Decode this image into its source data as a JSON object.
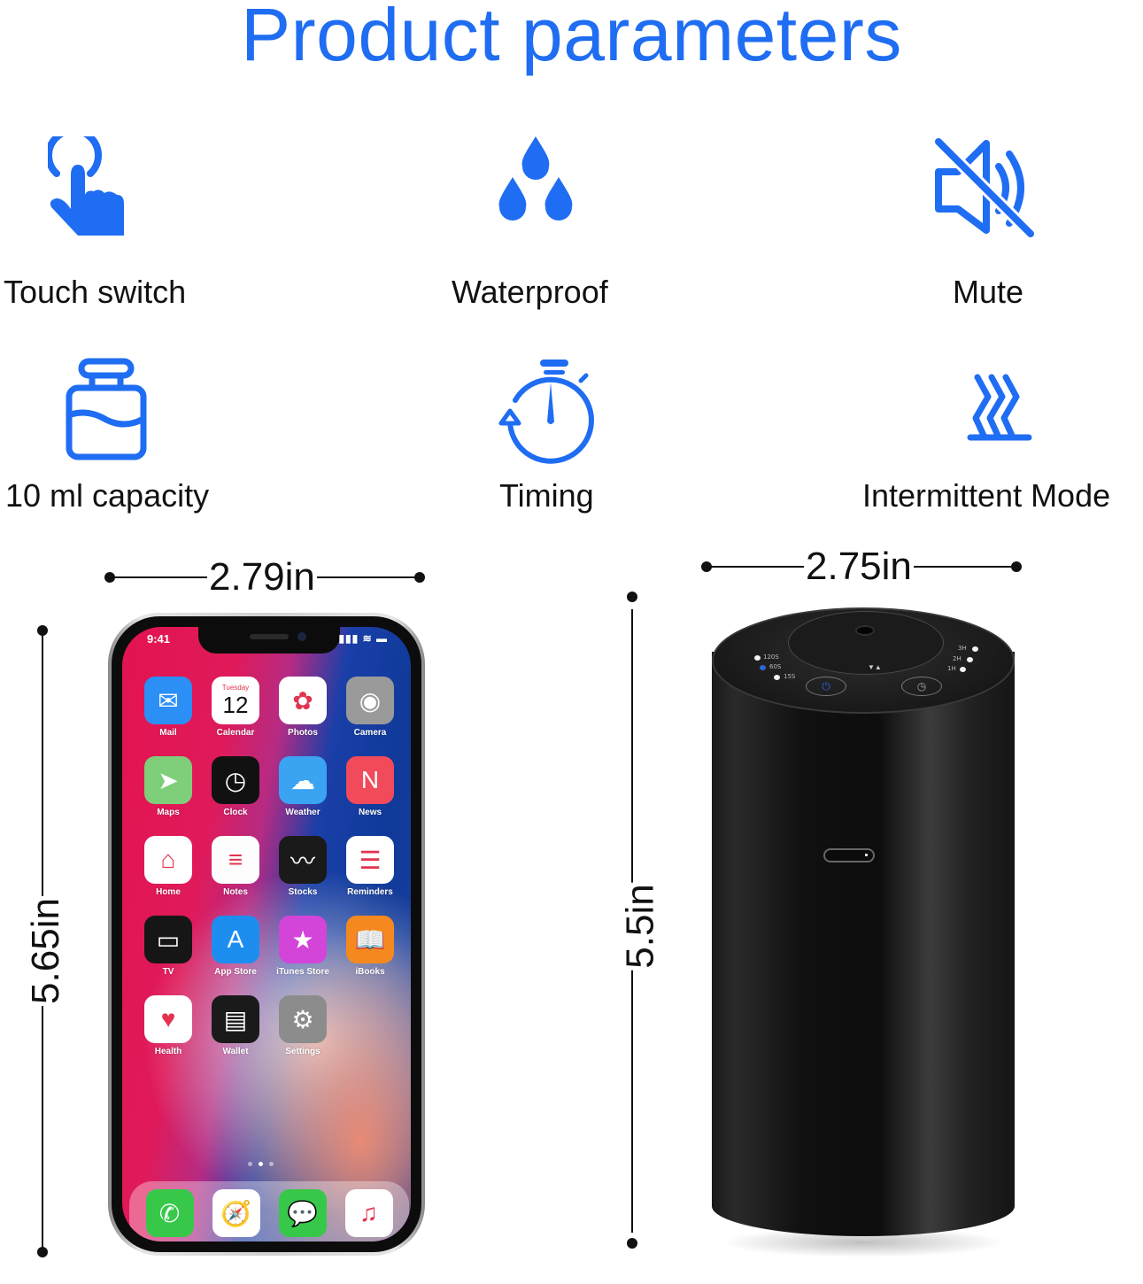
{
  "title": "Product parameters",
  "colors": {
    "accent": "#1f6df2",
    "text": "#111111"
  },
  "features": [
    {
      "label": "Touch switch",
      "icon": "touch-hand-icon"
    },
    {
      "label": "Waterproof",
      "icon": "water-drops-icon"
    },
    {
      "label": "Mute",
      "icon": "speaker-muted-icon"
    },
    {
      "label": "10 ml capacity",
      "icon": "bottle-icon"
    },
    {
      "label": "Timing",
      "icon": "stopwatch-icon"
    },
    {
      "label": "Intermittent Mode",
      "icon": "heat-waves-icon"
    }
  ],
  "dimensions": {
    "phone_width": "2.79in",
    "phone_height": "5.65in",
    "diffuser_width": "2.75in",
    "diffuser_height": "5.5in"
  },
  "phone": {
    "time": "9:41",
    "status_icons": "▮▮▮ ≋ ▬",
    "calendar_day": "Tuesday",
    "calendar_date": "12",
    "apps": [
      {
        "name": "Mail",
        "glyph": "✉",
        "color": "#2b8ff6"
      },
      {
        "name": "Calendar",
        "glyph": "12",
        "color": "#ffffff"
      },
      {
        "name": "Photos",
        "glyph": "✿",
        "color": "#ffffff"
      },
      {
        "name": "Camera",
        "glyph": "◉",
        "color": "#9a9a9a"
      },
      {
        "name": "Maps",
        "glyph": "➤",
        "color": "#7fcf7a"
      },
      {
        "name": "Clock",
        "glyph": "◷",
        "color": "#111111"
      },
      {
        "name": "Weather",
        "glyph": "☁",
        "color": "#3aa3f2"
      },
      {
        "name": "News",
        "glyph": "N",
        "color": "#f04a5b"
      },
      {
        "name": "Home",
        "glyph": "⌂",
        "color": "#ffffff"
      },
      {
        "name": "Notes",
        "glyph": "≡",
        "color": "#fdfdfd"
      },
      {
        "name": "Stocks",
        "glyph": "〰",
        "color": "#1a1a1a"
      },
      {
        "name": "Reminders",
        "glyph": "☰",
        "color": "#ffffff"
      },
      {
        "name": "TV",
        "glyph": "▭",
        "color": "#161616"
      },
      {
        "name": "App Store",
        "glyph": "A",
        "color": "#1d8ef0"
      },
      {
        "name": "iTunes Store",
        "glyph": "★",
        "color": "#d344d8"
      },
      {
        "name": "iBooks",
        "glyph": "📖",
        "color": "#f5891f"
      },
      {
        "name": "Health",
        "glyph": "♥",
        "color": "#ffffff"
      },
      {
        "name": "Wallet",
        "glyph": "▤",
        "color": "#1a1a1a"
      },
      {
        "name": "Settings",
        "glyph": "⚙",
        "color": "#8c8c8c"
      }
    ],
    "dock": [
      {
        "name": "Phone",
        "glyph": "✆",
        "color": "#37c84a"
      },
      {
        "name": "Safari",
        "glyph": "🧭",
        "color": "#ffffff"
      },
      {
        "name": "Messages",
        "glyph": "💬",
        "color": "#37c84a"
      },
      {
        "name": "Music",
        "glyph": "♫",
        "color": "#ffffff"
      }
    ]
  },
  "diffuser": {
    "intervals": [
      "120S",
      "60S",
      "15S"
    ],
    "active_interval": "60S",
    "timers": [
      "3H",
      "2H",
      "1H"
    ],
    "power_icon": "⏻",
    "timer_icon": "◷",
    "arrow_glyph": "▼▲"
  }
}
